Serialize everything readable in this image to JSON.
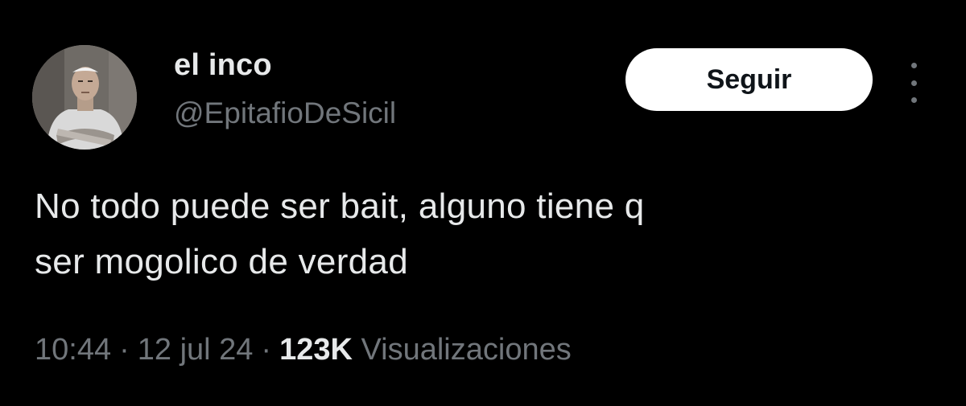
{
  "tweet": {
    "author": {
      "name": "el inco",
      "handle": "@EpitafioDeSicil"
    },
    "follow_label": "Seguir",
    "more_icon": "more-vertical-icon",
    "text_lines": [
      "No todo puede ser bait, alguno tiene q",
      "ser mogolico de verdad"
    ],
    "time": "10:44",
    "date": "12 jul 24",
    "separator": "·",
    "views_count": "123K",
    "views_label": "Visualizaciones"
  },
  "colors": {
    "background": "#000000",
    "primary_text": "#e7e9ea",
    "secondary_text": "#71767b",
    "button_bg": "#ffffff",
    "button_text": "#0f1419"
  }
}
